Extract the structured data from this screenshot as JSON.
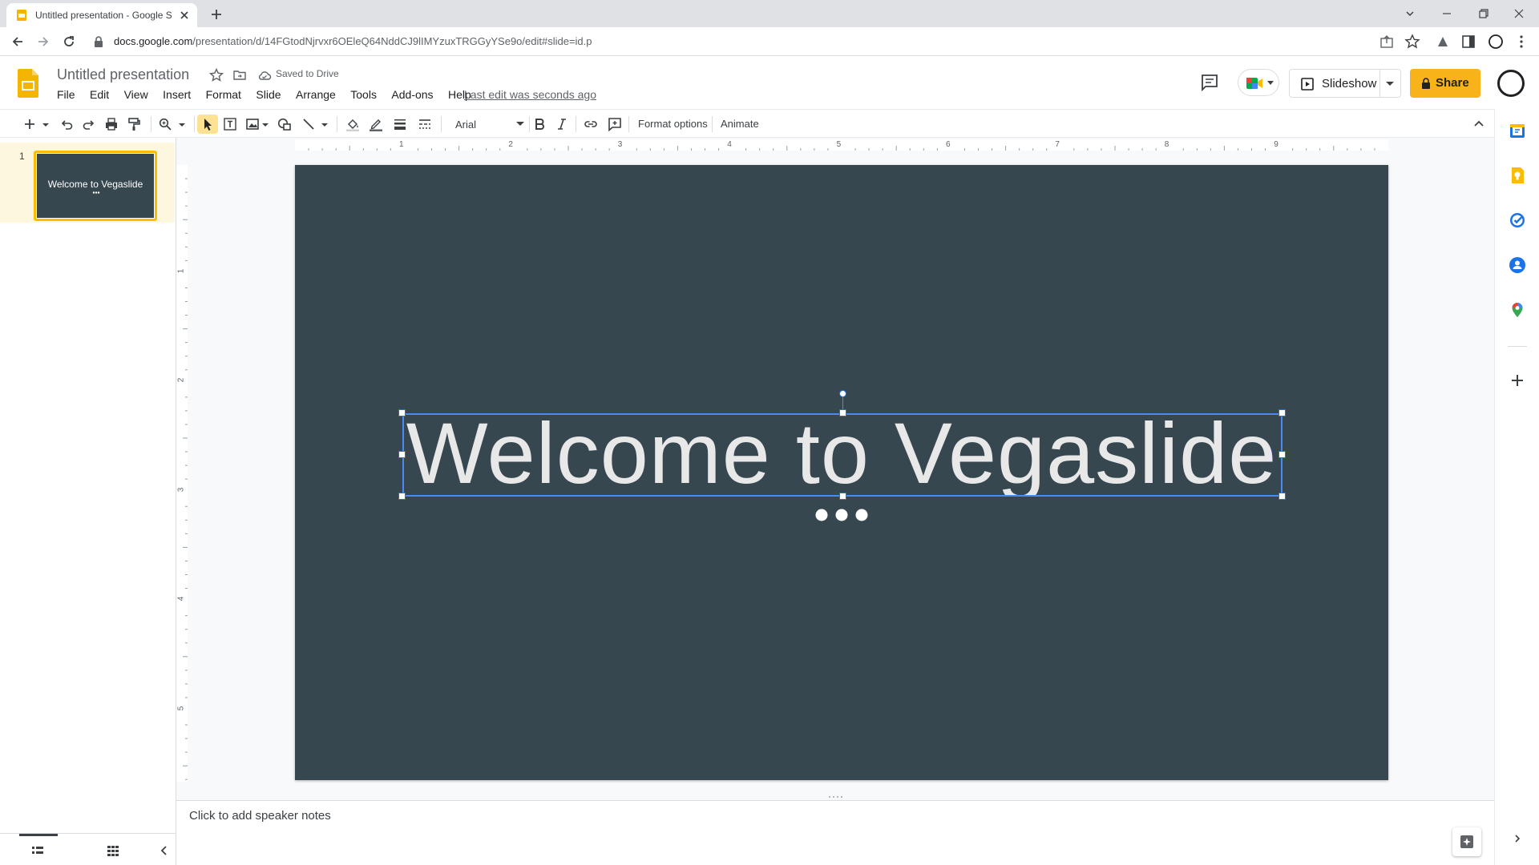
{
  "browser": {
    "tab_title": "Untitled presentation - Google Sl",
    "url_host": "docs.google.com",
    "url_path": "/presentation/d/14FGtodNjrvxr6OEleQ64NddCJ9lIMYzuxTRGGyYSe9o/edit#slide=id.p"
  },
  "doc": {
    "title": "Untitled presentation",
    "saved_status": "Saved to Drive",
    "last_edit": "Last edit was seconds ago"
  },
  "menu": {
    "file": "File",
    "edit": "Edit",
    "view": "View",
    "insert": "Insert",
    "format": "Format",
    "slide": "Slide",
    "arrange": "Arrange",
    "tools": "Tools",
    "addons": "Add-ons",
    "help": "Help"
  },
  "header_buttons": {
    "slideshow": "Slideshow",
    "share": "Share"
  },
  "toolbar": {
    "font": "Arial",
    "format_options": "Format options",
    "animate": "Animate"
  },
  "filmstrip": {
    "slides": [
      {
        "number": "1",
        "text": "Welcome to Vegaslide"
      }
    ]
  },
  "slide": {
    "title": "Welcome to Vegaslide",
    "background": "#37474f"
  },
  "ruler": {
    "horizontal": [
      "1",
      "2",
      "3",
      "4",
      "5",
      "6",
      "7",
      "8",
      "9"
    ],
    "vertical": [
      "1",
      "2",
      "3",
      "4",
      "5"
    ]
  },
  "notes": {
    "placeholder": "Click to add speaker notes"
  },
  "colors": {
    "accent": "#fbbc04",
    "share_button": "#f8b31b",
    "selection": "#1a73e8"
  }
}
